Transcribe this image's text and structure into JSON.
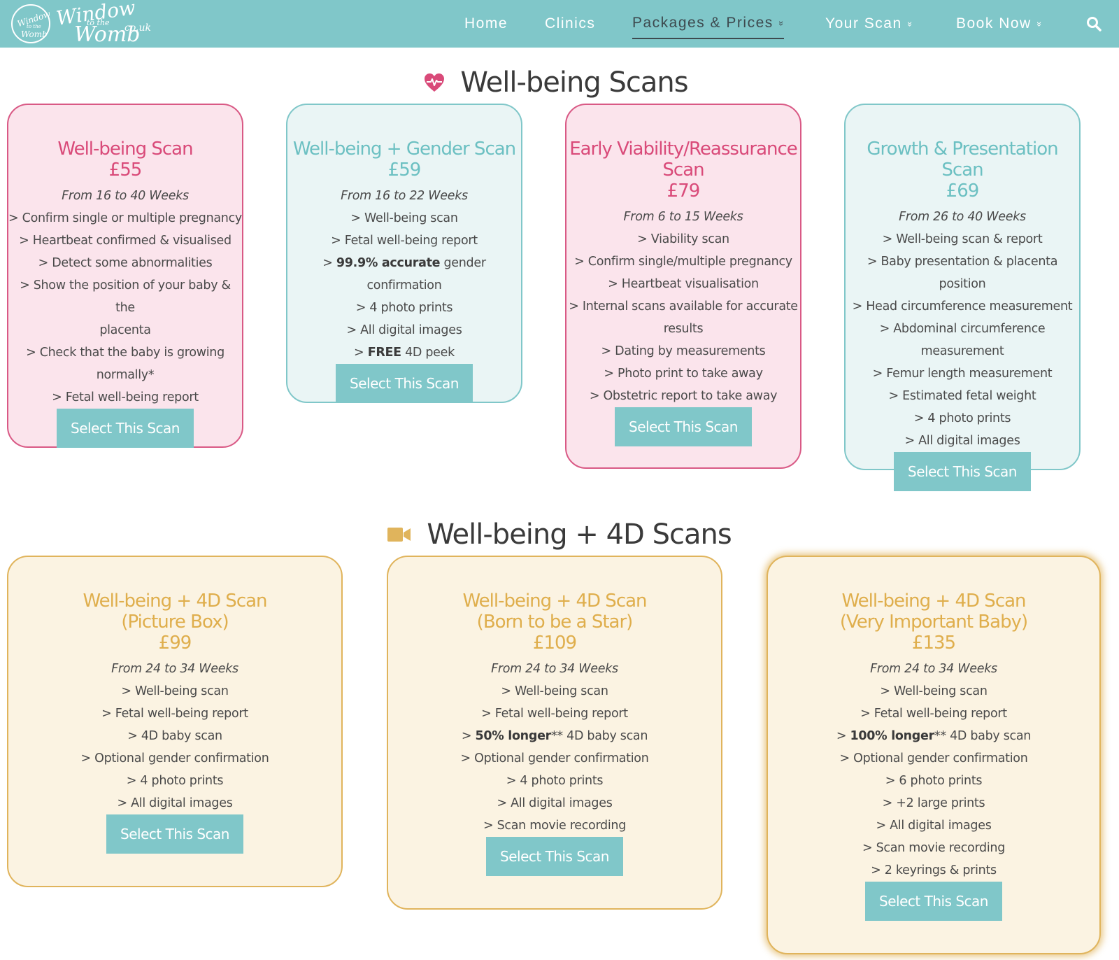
{
  "header": {
    "logo_badge": [
      "Window",
      "to the",
      "Womb"
    ],
    "logo_text": [
      "Window",
      "to the",
      "Womb",
      "co.uk"
    ],
    "nav": [
      {
        "label": "Home"
      },
      {
        "label": "Clinics"
      },
      {
        "label": "Packages & Prices",
        "active": true,
        "dropdown": true
      },
      {
        "label": "Your Scan",
        "dropdown": true
      },
      {
        "label": "Book Now",
        "dropdown": true
      }
    ],
    "chevron": "»"
  },
  "sections": [
    {
      "title": "Well-being Scans",
      "icon": "heartbeat-icon",
      "cards": [
        {
          "title": [
            "Well-being Scan"
          ],
          "price": "£55",
          "weeks": "From 16 to 40 Weeks",
          "features": [
            {
              "text": "> Confirm single or multiple pregnancy"
            },
            {
              "text": "> Heartbeat confirmed & visualised"
            },
            {
              "text": "> Detect some abnormalities"
            },
            {
              "text": "> Show the position of your baby & the"
            },
            {
              "text": "placenta"
            },
            {
              "text": "> Check that the baby is growing"
            },
            {
              "text": "normally*"
            },
            {
              "text": "> Fetal well-being report"
            }
          ],
          "button": "Select This Scan"
        },
        {
          "title": [
            "Well-being + Gender Scan"
          ],
          "price": "£59",
          "weeks": "From 16 to 22 Weeks",
          "features": [
            {
              "text": "> Well-being scan"
            },
            {
              "text": "> Fetal well-being report"
            },
            {
              "pre": "> ",
              "bold": "99.9% accurate",
              "post": " gender confirmation"
            },
            {
              "text": "> 4 photo prints"
            },
            {
              "text": "> All digital images"
            },
            {
              "pre": "> ",
              "bold": "FREE",
              "post": " 4D peek"
            }
          ],
          "button": "Select This Scan"
        },
        {
          "title": [
            "Early Viability/Reassurance",
            "Scan"
          ],
          "price": "£79",
          "weeks": "From 6 to 15 Weeks",
          "features": [
            {
              "text": "> Viability scan"
            },
            {
              "text": "> Confirm single/multiple pregnancy"
            },
            {
              "text": "> Heartbeat visualisation"
            },
            {
              "text": "> Internal scans available for accurate"
            },
            {
              "text": "results"
            },
            {
              "text": "> Dating by measurements"
            },
            {
              "text": "> Photo print to take away"
            },
            {
              "text": "> Obstetric report to take away"
            }
          ],
          "button": "Select This Scan"
        },
        {
          "title": [
            "Growth & Presentation Scan"
          ],
          "price": "£69",
          "weeks": "From 26 to 40 Weeks",
          "features": [
            {
              "text": "> Well-being scan & report"
            },
            {
              "text": "> Baby presentation & placenta position"
            },
            {
              "text": "> Head circumference measurement"
            },
            {
              "text": "> Abdominal circumference"
            },
            {
              "text": "measurement"
            },
            {
              "text": "> Femur length measurement"
            },
            {
              "text": "> Estimated fetal weight"
            },
            {
              "text": "> 4 photo prints"
            },
            {
              "text": "> All digital images"
            }
          ],
          "button": "Select This Scan"
        }
      ]
    },
    {
      "title": "Well-being + 4D Scans",
      "icon": "video-camera-icon",
      "cards": [
        {
          "title": [
            "Well-being + 4D Scan",
            "(Picture Box)"
          ],
          "price": "£99",
          "weeks": "From 24 to 34 Weeks",
          "features": [
            {
              "text": "> Well-being scan"
            },
            {
              "text": "> Fetal well-being report"
            },
            {
              "text": "> 4D baby scan"
            },
            {
              "text": "> Optional gender confirmation"
            },
            {
              "text": "> 4 photo prints"
            },
            {
              "text": "> All digital images"
            }
          ],
          "button": "Select This Scan"
        },
        {
          "title": [
            "Well-being + 4D Scan",
            "(Born to be a Star)"
          ],
          "price": "£109",
          "weeks": "From 24 to 34 Weeks",
          "features": [
            {
              "text": "> Well-being scan"
            },
            {
              "text": "> Fetal well-being report"
            },
            {
              "pre": "> ",
              "bold": "50% longer",
              "post": "** 4D baby scan"
            },
            {
              "text": "> Optional gender confirmation"
            },
            {
              "text": "> 4 photo prints"
            },
            {
              "text": "> All digital images"
            },
            {
              "text": "> Scan movie recording"
            }
          ],
          "button": "Select This Scan"
        },
        {
          "title": [
            "Well-being + 4D Scan",
            "(Very Important Baby)"
          ],
          "price": "£135",
          "weeks": "From 24 to 34 Weeks",
          "features": [
            {
              "text": "> Well-being scan"
            },
            {
              "text": "> Fetal well-being report"
            },
            {
              "pre": "> ",
              "bold": "100% longer",
              "post": "** 4D baby scan"
            },
            {
              "text": "> Optional gender confirmation"
            },
            {
              "text": "> 6 photo prints"
            },
            {
              "text": "> +2 large prints"
            },
            {
              "text": "> All digital images"
            },
            {
              "text": "> Scan movie recording"
            },
            {
              "text": "> 2 keyrings & prints"
            }
          ],
          "button": "Select This Scan"
        }
      ]
    }
  ],
  "colors": {
    "brand_teal": "#80c7c9",
    "pink": "#d94a79",
    "pink_bg": "#fbe4ec",
    "teal_bg": "#eaf5f5",
    "gold": "#dfae4c",
    "gold_bg": "#fbf3e2",
    "camera": "#e0b45c"
  }
}
